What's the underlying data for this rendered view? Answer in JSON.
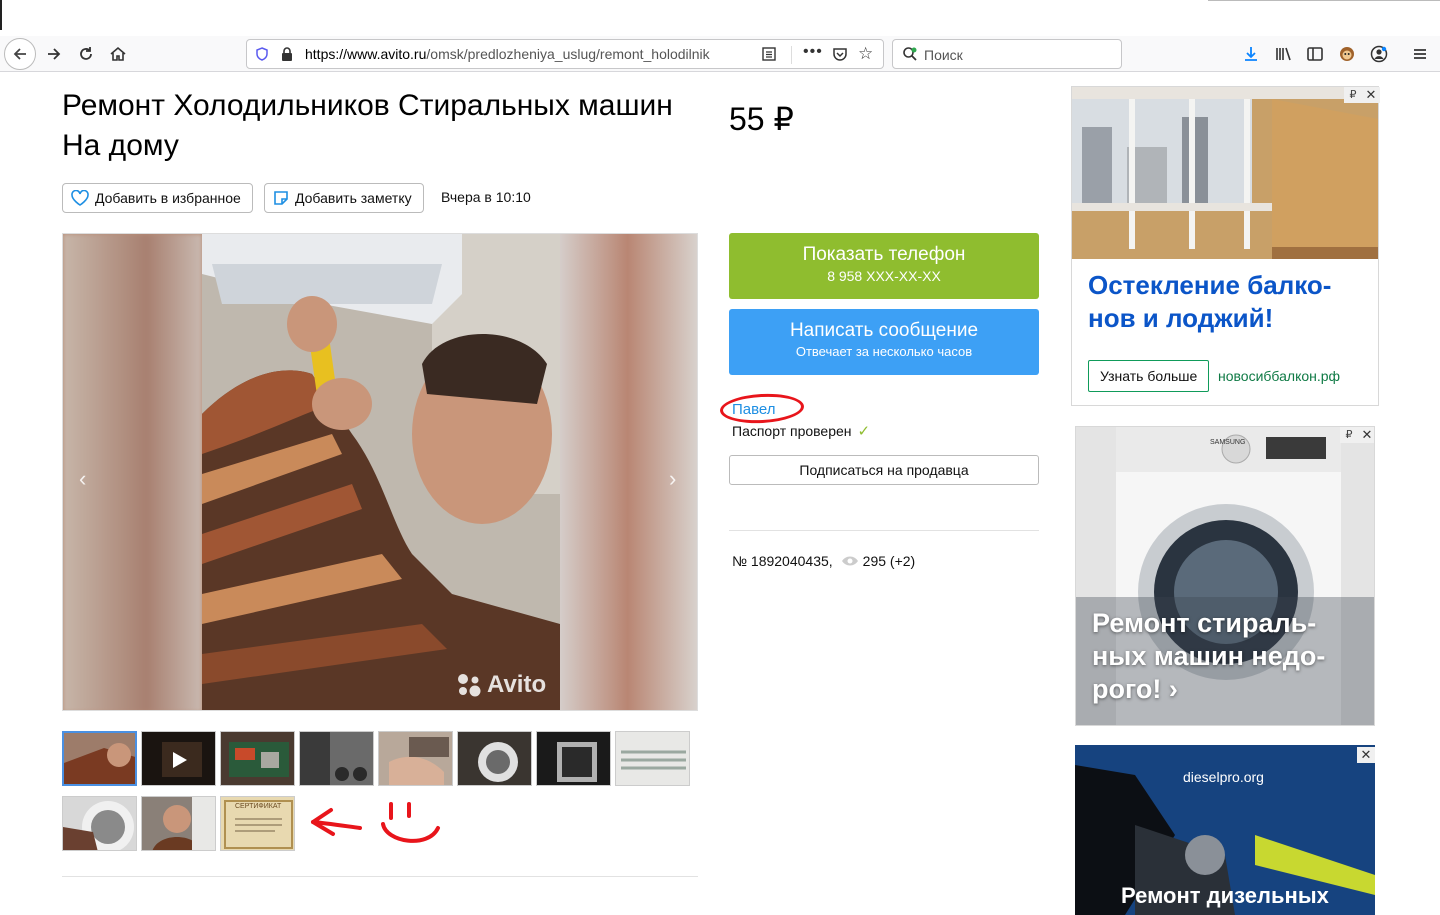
{
  "browser": {
    "url_host": "https://www.avito.ru",
    "url_path": "/omsk/predlozheniya_uslug/remont_holodilnik",
    "search_placeholder": "Поиск"
  },
  "listing": {
    "title": "Ремонт Холодильников Стиральных машин На дому",
    "price": "55 ₽",
    "favorite_label": "Добавить в избранное",
    "note_label": "Добавить заметку",
    "posted": "Вчера в 10:10",
    "watermark": "Avito",
    "id_text": "№ 1892040435,",
    "views_text": "295 (+2)"
  },
  "contact": {
    "phone_label": "Показать телефон",
    "phone_masked": "8 958 XXX-XX-XX",
    "message_label": "Написать сообщение",
    "message_sub": "Отвечает за несколько часов",
    "seller_name": "Павел",
    "passport": "Паспорт проверен",
    "subscribe_label": "Подписаться на продавца"
  },
  "thumbnails": {
    "certificate_text": "СЕРТИФИКАТ"
  },
  "ads": {
    "ad1": {
      "tag": "₽",
      "headline": "Остекление балко-нов и лоджий!",
      "button": "Узнать больше",
      "domain": "новосиббалкон.рф"
    },
    "ad2": {
      "tag": "₽",
      "brand": "SAMSUNG",
      "headline": "Ремонт стираль-ных машин недо-рого! ›"
    },
    "ad3": {
      "domain": "dieselpro.org",
      "headline": "Ремонт дизельных"
    }
  },
  "colors": {
    "phone_button": "#8fbd2f",
    "message_button": "#3da0f5",
    "seller_link": "#1e8fe3",
    "annotation_red": "#e8151b"
  }
}
